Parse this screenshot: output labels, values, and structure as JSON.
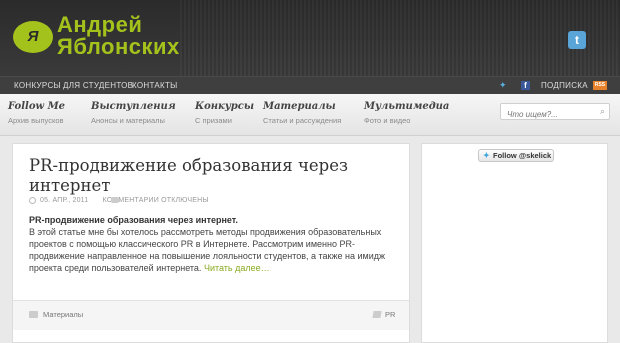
{
  "header": {
    "logo_badge": "Я",
    "logo_line1": "Андрей",
    "logo_line2": "Яблонских",
    "twitter_icon": "twitter-icon"
  },
  "topnav": {
    "items": [
      "КОНКУРСЫ",
      "ДЛЯ СТУДЕНТОВ",
      "КОНТАКТЫ"
    ],
    "subscribe": "ПОДПИСКА",
    "rss": "RSS"
  },
  "menu": [
    {
      "title": "Follow Me",
      "sub": "Архив выпусков"
    },
    {
      "title": "Выступления",
      "sub": "Анонсы и материалы"
    },
    {
      "title": "Конкурсы",
      "sub": "С призами"
    },
    {
      "title": "Материалы",
      "sub": "Статьи и рассуждения"
    },
    {
      "title": "Мультимедиа",
      "sub": "Фото и видео"
    }
  ],
  "search": {
    "placeholder": "Что ищем?..."
  },
  "post": {
    "title": "PR-продвижение образования через интернет",
    "date": "05. АПР., 2011",
    "comments": "КОММЕНТАРИИ ОТКЛЮЧЕНЫ",
    "lead": "PR-продвижение образования через интернет.",
    "body": "В этой статье мне бы хотелось рассмотреть методы продвижения образовательных проектов с помощью классического PR в Интернете. Рассмотрим именно PR-продвижение направленное на повышение лояльности студентов, а также на имидж проекта среди пользователей интернета.",
    "more": "Читать далее…",
    "category": "Материалы",
    "tag": "PR"
  },
  "sidebar": {
    "follow_label": "Follow @skelick"
  },
  "colors": {
    "accent": "#a4c21c",
    "link": "#8aab22"
  }
}
